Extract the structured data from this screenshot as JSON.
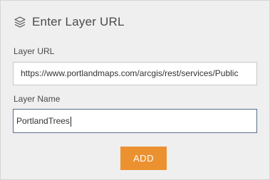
{
  "header": {
    "icon": "layers-icon",
    "title": "Enter Layer URL"
  },
  "layer_url": {
    "label": "Layer URL",
    "value": "https://www.portlandmaps.com/arcgis/rest/services/Public"
  },
  "layer_name": {
    "label": "Layer Name",
    "value": "PortlandTrees"
  },
  "actions": {
    "add_label": "ADD"
  },
  "colors": {
    "panel_bg": "#efefef",
    "button_bg": "#ec9130",
    "focused_border": "#5a6e87"
  }
}
